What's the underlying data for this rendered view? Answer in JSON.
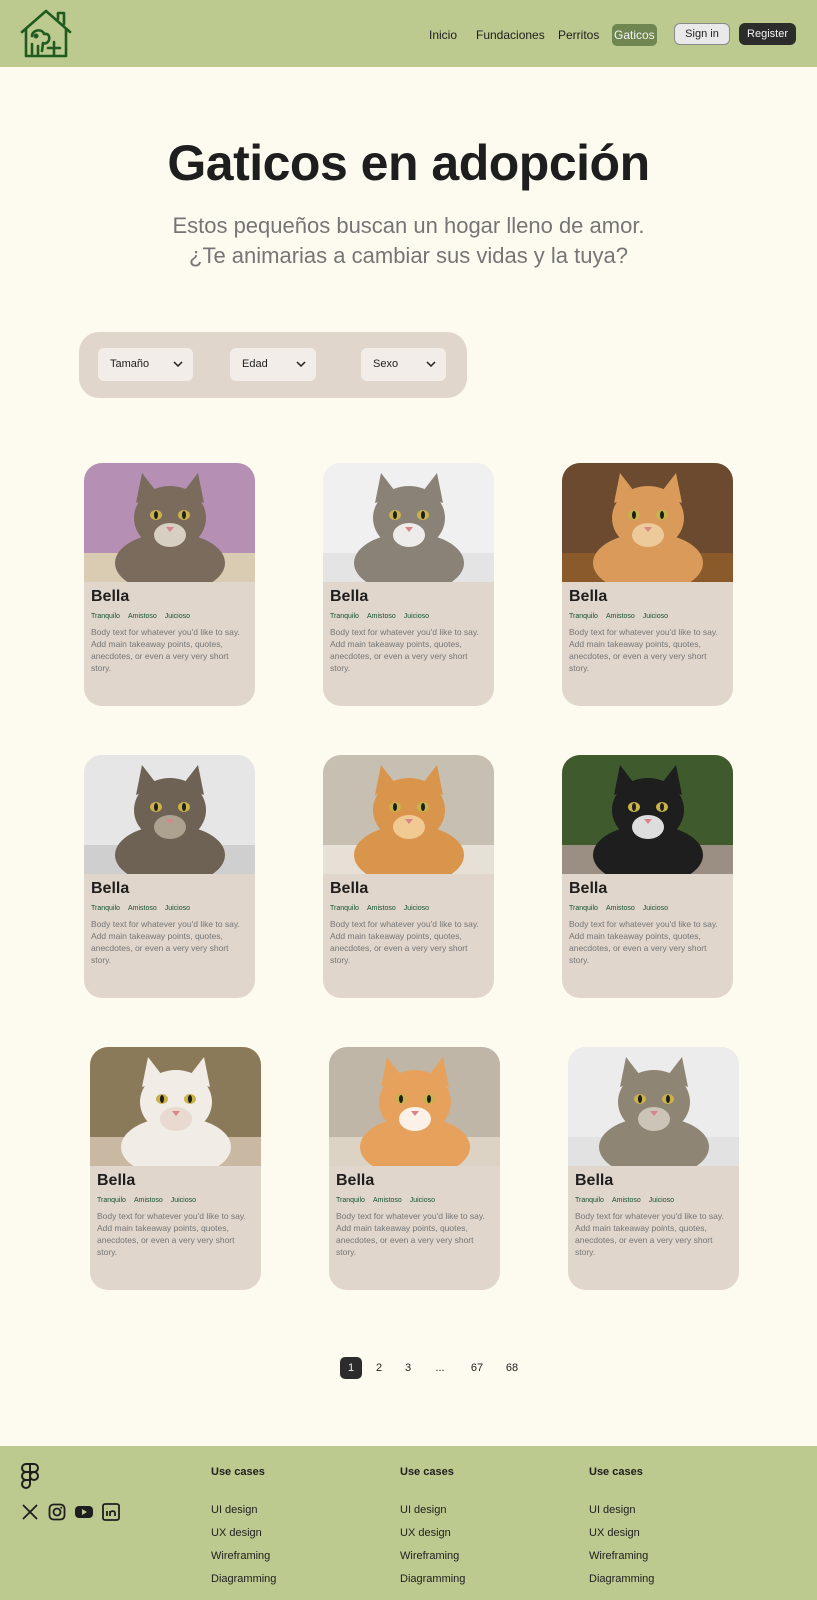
{
  "nav": {
    "links": [
      "Inicio",
      "Fundaciones",
      "Perritos",
      "Gaticos"
    ],
    "active": "Gaticos",
    "sign_in": "Sign in",
    "register": "Register"
  },
  "hero": {
    "title": "Gaticos en adopción",
    "subtitle_line1": "Estos pequeños buscan un hogar lleno de amor.",
    "subtitle_line2": "¿Te animarias a cambiar sus vidas y la tuya?"
  },
  "filters": [
    "Tamaño",
    "Edad",
    "Sexo"
  ],
  "cards": [
    {
      "name": "Bella",
      "tags": [
        "Tranquilo",
        "Amistoso",
        "Juicioso"
      ],
      "body": "Body text for whatever you'd like to say. Add main takeaway points, quotes, anecdotes, or even a very very short story."
    },
    {
      "name": "Bella",
      "tags": [
        "Tranquilo",
        "Amistoso",
        "Juicioso"
      ],
      "body": "Body text for whatever you'd like to say. Add main takeaway points, quotes, anecdotes, or even a very very short story."
    },
    {
      "name": "Bella",
      "tags": [
        "Tranquilo",
        "Amistoso",
        "Juicioso"
      ],
      "body": "Body text for whatever you'd like to say. Add main takeaway points, quotes, anecdotes, or even a very very short story."
    },
    {
      "name": "Bella",
      "tags": [
        "Tranquilo",
        "Amistoso",
        "Juicioso"
      ],
      "body": "Body text for whatever you'd like to say. Add main takeaway points, quotes, anecdotes, or even a very very short story."
    },
    {
      "name": "Bella",
      "tags": [
        "Tranquilo",
        "Amistoso",
        "Juicioso"
      ],
      "body": "Body text for whatever you'd like to say. Add main takeaway points, quotes, anecdotes, or even a very very short story."
    },
    {
      "name": "Bella",
      "tags": [
        "Tranquilo",
        "Amistoso",
        "Juicioso"
      ],
      "body": "Body text for whatever you'd like to say. Add main takeaway points, quotes, anecdotes, or even a very very short story."
    },
    {
      "name": "Bella",
      "tags": [
        "Tranquilo",
        "Amistoso",
        "Juicioso"
      ],
      "body": "Body text for whatever you'd like to say. Add main takeaway points, quotes, anecdotes, or even a very very short story."
    },
    {
      "name": "Bella",
      "tags": [
        "Tranquilo",
        "Amistoso",
        "Juicioso"
      ],
      "body": "Body text for whatever you'd like to say. Add main takeaway points, quotes, anecdotes, or even a very very short story."
    },
    {
      "name": "Bella",
      "tags": [
        "Tranquilo",
        "Amistoso",
        "Juicioso"
      ],
      "body": "Body text for whatever you'd like to say. Add main takeaway points, quotes, anecdotes, or even a very very short story."
    }
  ],
  "pagination": [
    "1",
    "2",
    "3",
    "...",
    "67",
    "68"
  ],
  "pagination_active": "1",
  "footer": {
    "columns": [
      {
        "title": "Use cases",
        "links": [
          "UI design",
          "UX design",
          "Wireframing",
          "Diagramming"
        ]
      },
      {
        "title": "Use cases",
        "links": [
          "UI design",
          "UX design",
          "Wireframing",
          "Diagramming"
        ]
      },
      {
        "title": "Use cases",
        "links": [
          "UI design",
          "UX design",
          "Wireframing",
          "Diagramming"
        ]
      }
    ],
    "icons": [
      "figma-icon",
      "x-icon",
      "instagram-icon",
      "youtube-icon",
      "linkedin-icon"
    ]
  },
  "colors": {
    "header_bg": "#bcc98f",
    "page_bg": "#fdfbf0",
    "card_bg": "#e0d6cb",
    "active_nav": "#6f8650",
    "tag_green": "#14532d",
    "dark_button": "#2c2c2c"
  }
}
